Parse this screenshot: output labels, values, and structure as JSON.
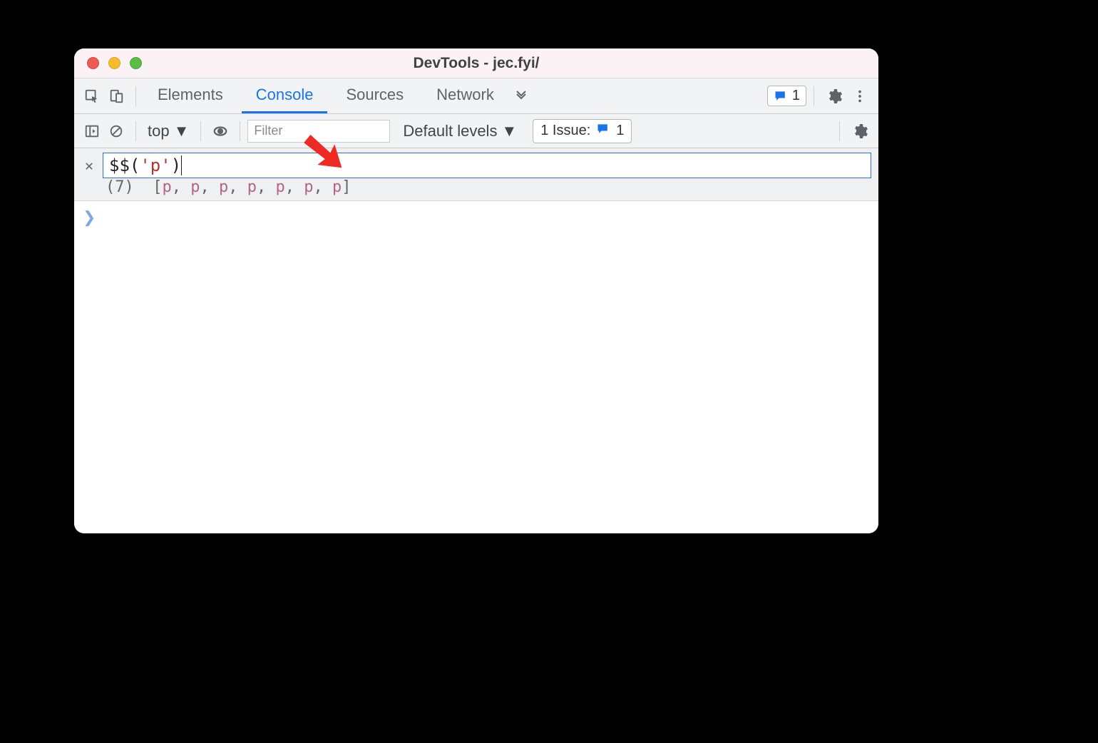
{
  "window": {
    "title": "DevTools - jec.fyi/"
  },
  "mainToolbar": {
    "tabs": [
      "Elements",
      "Console",
      "Sources",
      "Network"
    ],
    "activeTab": "Console",
    "feedbackCount": "1"
  },
  "consoleToolbar": {
    "context": "top",
    "filterPlaceholder": "Filter",
    "levels": "Default levels",
    "issueLabel": "1 Issue:",
    "issueCount": "1"
  },
  "eager": {
    "input": {
      "dollar": "$$",
      "open": "(",
      "str": "'p'",
      "close": ")"
    },
    "result": {
      "count": "(7)",
      "items": [
        "p",
        "p",
        "p",
        "p",
        "p",
        "p",
        "p"
      ]
    }
  }
}
